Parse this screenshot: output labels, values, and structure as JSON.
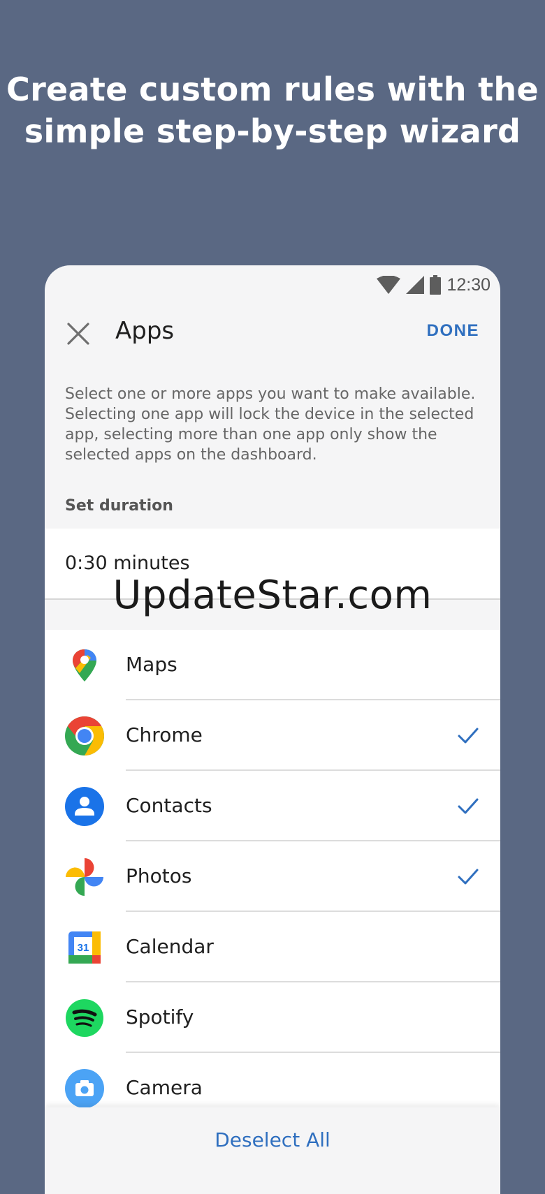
{
  "headline": "Create custom rules with the simple step-by-step wizard",
  "status_bar": {
    "time": "12:30",
    "icons": [
      "wifi-icon",
      "cell-signal-icon",
      "battery-icon"
    ]
  },
  "app_bar": {
    "title": "Apps",
    "done_label": "DONE",
    "close_icon": "close-icon"
  },
  "description": "Select one or more apps you want to make available. Selecting one app will lock the device in the selected app, selecting more than one app only show the selected apps on the dashboard.",
  "duration": {
    "label": "Set duration",
    "value": "0:30 minutes"
  },
  "watermark": "UpdateStar.com",
  "apps": [
    {
      "name": "Maps",
      "icon": "maps-icon",
      "selected": false
    },
    {
      "name": "Chrome",
      "icon": "chrome-icon",
      "selected": true
    },
    {
      "name": "Contacts",
      "icon": "contacts-icon",
      "selected": true
    },
    {
      "name": "Photos",
      "icon": "photos-icon",
      "selected": true
    },
    {
      "name": "Calendar",
      "icon": "calendar-icon",
      "selected": false,
      "icon_text": "31"
    },
    {
      "name": "Spotify",
      "icon": "spotify-icon",
      "selected": false
    },
    {
      "name": "Camera",
      "icon": "camera-icon",
      "selected": false
    }
  ],
  "footer": {
    "deselect_label": "Deselect All"
  },
  "colors": {
    "background": "#5a6883",
    "accent": "#2f6fbf",
    "card": "#f5f5f6"
  }
}
